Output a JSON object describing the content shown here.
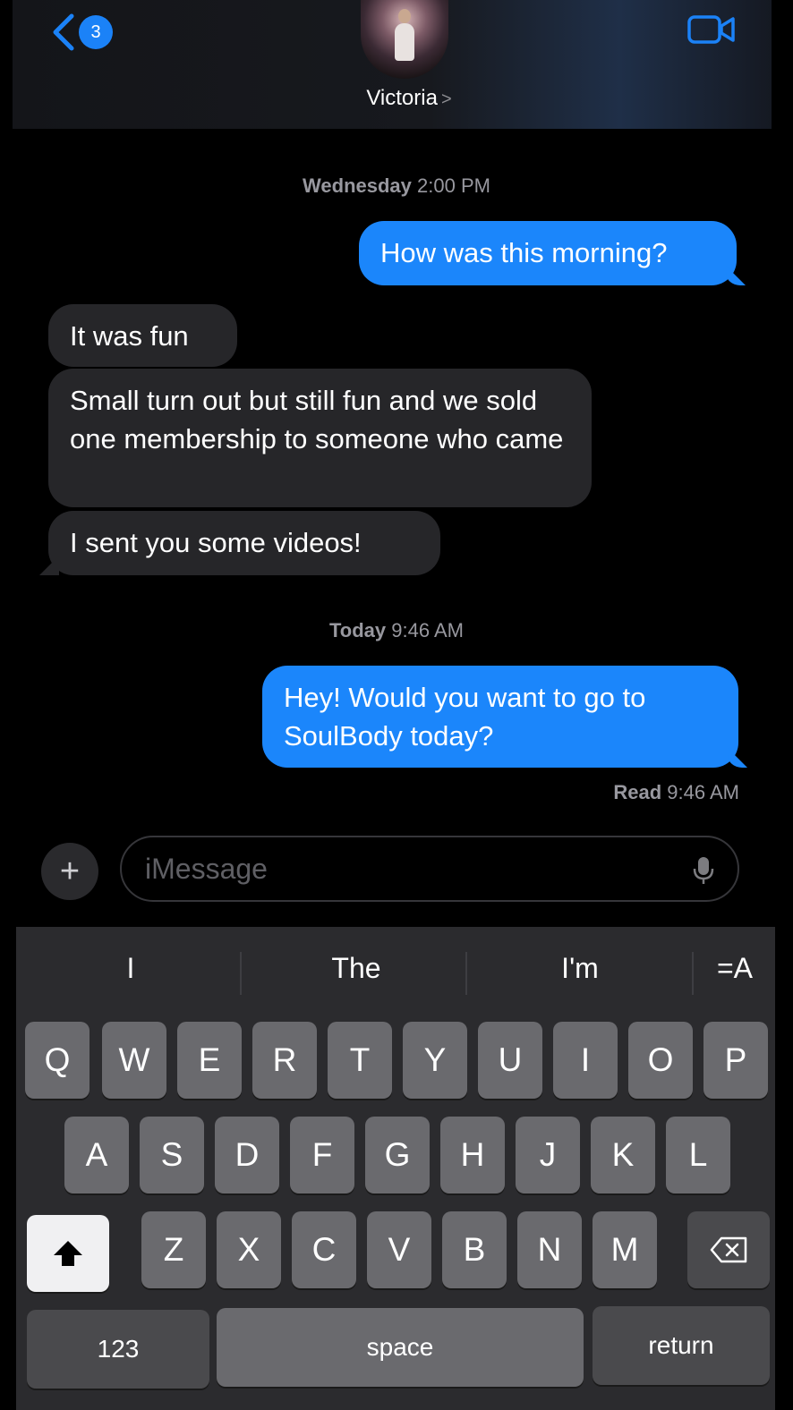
{
  "header": {
    "back_count": "3",
    "contact_name": "Victoria",
    "chevron": ">"
  },
  "thread": {
    "timestamp_1": {
      "day": "Wednesday",
      "time": "2:00 PM"
    },
    "msg_sent_1": "How was this morning?",
    "msg_recv_1": "It was fun",
    "msg_recv_2": "Small turn out but still fun and we sold one membership to someone who came",
    "msg_recv_3": "I sent you some videos!",
    "timestamp_2": {
      "day": "Today",
      "time": "9:46 AM"
    },
    "msg_sent_2": "Hey! Would you want to go to SoulBody today?",
    "read_receipt": {
      "label": "Read",
      "time": "9:46 AM"
    }
  },
  "input": {
    "plus": "+",
    "placeholder": "iMessage"
  },
  "keyboard": {
    "suggestions": [
      "I",
      "The",
      "I'm",
      "=A"
    ],
    "row1": [
      "Q",
      "W",
      "E",
      "R",
      "T",
      "Y",
      "U",
      "I",
      "O",
      "P"
    ],
    "row2": [
      "A",
      "S",
      "D",
      "F",
      "G",
      "H",
      "J",
      "K",
      "L"
    ],
    "row3": [
      "Z",
      "X",
      "C",
      "V",
      "B",
      "N",
      "M"
    ],
    "numbers_label": "123",
    "space_label": "space",
    "return_label": "return"
  },
  "colors": {
    "sent_bubble": "#1b86fb",
    "received_bubble": "#262629",
    "accent": "#1b82f7"
  }
}
